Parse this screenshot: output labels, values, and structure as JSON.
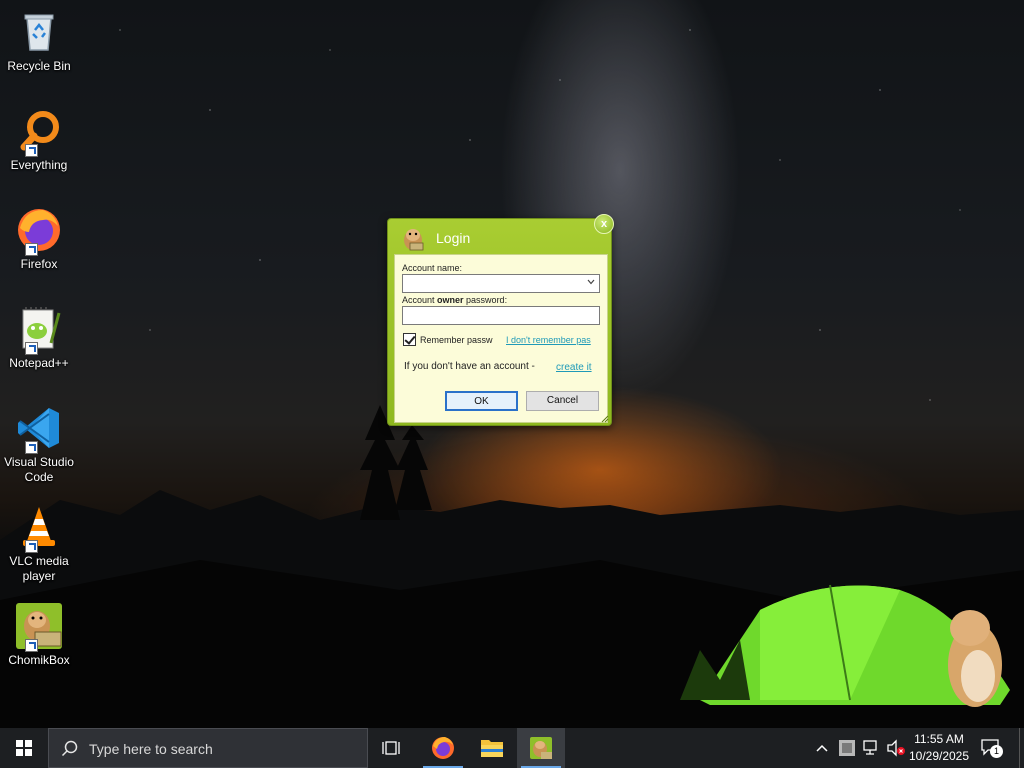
{
  "desktop": {
    "icons": [
      {
        "label": "Recycle Bin"
      },
      {
        "label": "Everything"
      },
      {
        "label": "Firefox"
      },
      {
        "label": "Notepad++"
      },
      {
        "label": "Visual Studio Code"
      },
      {
        "label": "VLC media player"
      },
      {
        "label": "ChomikBox"
      }
    ]
  },
  "login_dialog": {
    "title": "Login",
    "close_label": "x",
    "account_name_label_a": "Account name:",
    "password_label_a": "Account ",
    "password_label_bold": "owner",
    "password_label_b": " password:",
    "account_name_value": "",
    "password_value": "",
    "remember_label": "Remember passw",
    "remember_checked": true,
    "forgot_link": "I don't remember pas",
    "no_account_text": "If you don't have an account - ",
    "create_link": "create it",
    "ok_label": "OK",
    "cancel_label": "Cancel",
    "accent_color": "#9dc32a"
  },
  "taskbar": {
    "search_placeholder": "Type here to search",
    "time": "11:55 AM",
    "date": "10/29/2025",
    "notification_count": "1",
    "pinned": [
      "task-view",
      "firefox",
      "file-explorer",
      "chomikbox"
    ]
  }
}
